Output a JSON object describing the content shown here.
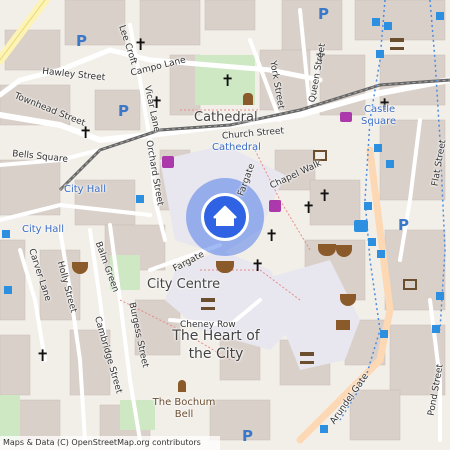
{
  "map": {
    "attribution": "Maps & Data (C) OpenStreetMap.org contributors",
    "current_location_marker": "home-icon",
    "area_labels": {
      "cathedral": "Cathedral",
      "city_centre": "City Centre",
      "heart_of_city_line1": "The Heart of",
      "heart_of_city_line2": "the City",
      "castle_square_line1": "Castle",
      "castle_square_line2": "Square"
    },
    "street_labels": {
      "hawley": "Hawley Street",
      "campo": "Campo Lane",
      "lee_croft": "Lee Croft",
      "york": "York Street",
      "queen": "Queen Street",
      "townhead": "Townhead Street",
      "vicar": "Vicar Lane",
      "church": "Church Street",
      "bells": "Bells Square",
      "orchard": "Orchard Street",
      "fargate_upper": "Fargate",
      "chapel_walk": "Chapel Walk",
      "fargate_lower": "Fargate",
      "flat": "Flat Street",
      "carver": "Carver Lane",
      "holly": "Holly Street",
      "balm_green": "Balm Green",
      "cambridge": "Cambridge Street",
      "burgess": "Burgess Street",
      "cheney_row": "Cheney Row",
      "arundel_gate": "Arundel Gate",
      "pond": "Pond Street"
    },
    "poi_labels": {
      "cathedral_tram": "Cathedral",
      "castle_square_tram": "Castle Square",
      "city_hall_upper": "City Hall",
      "city_hall_lower": "City Hall",
      "bochum_bell_line1": "The Bochum",
      "bochum_bell_line2": "Bell"
    },
    "parking_symbol": "P",
    "church_symbol": "✝"
  }
}
